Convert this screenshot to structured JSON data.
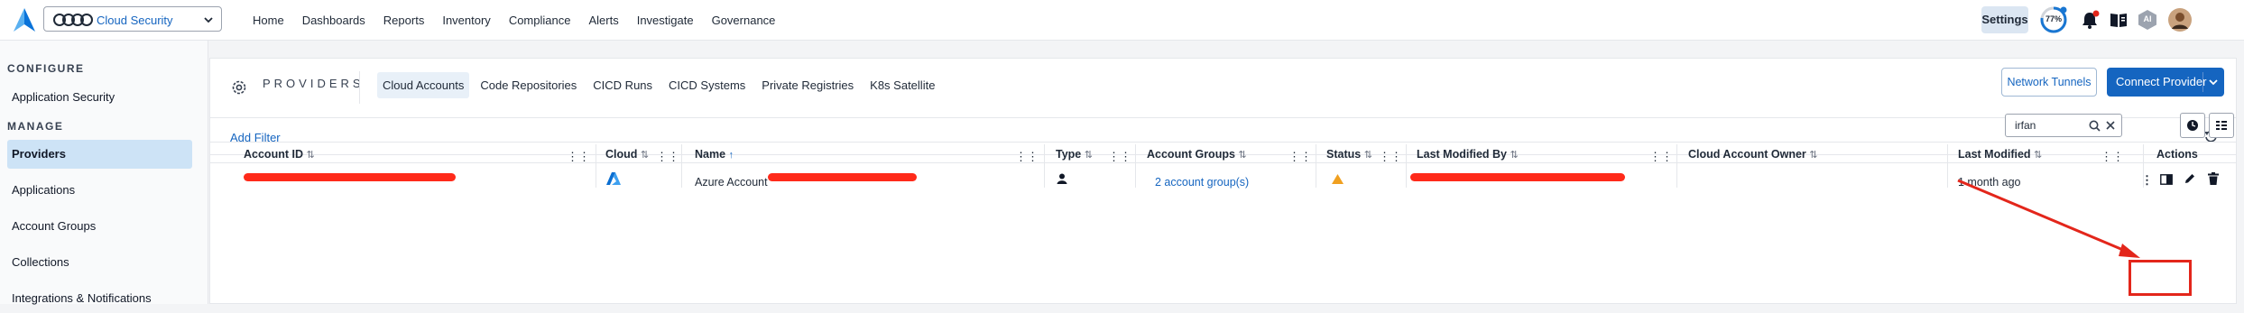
{
  "topbar": {
    "product": "Cloud Security",
    "nav": [
      "Home",
      "Dashboards",
      "Reports",
      "Inventory",
      "Compliance",
      "Alerts",
      "Investigate",
      "Governance"
    ],
    "settings": "Settings",
    "progress": "77%",
    "progress_value": 0.77,
    "avatar_badge": "AI"
  },
  "sidebar": {
    "configure_label": "CONFIGURE",
    "configure_items": [
      "Application Security"
    ],
    "manage_label": "MANAGE",
    "manage_items": [
      "Providers",
      "Applications",
      "Account Groups",
      "Collections",
      "Integrations & Notifications"
    ],
    "active_item": "Providers"
  },
  "page": {
    "title": "PROVIDERS",
    "tabs": [
      "Cloud Accounts",
      "Code Repositories",
      "CICD Runs",
      "CICD Systems",
      "Private Registries",
      "K8s Satellite"
    ],
    "active_tab": "Cloud Accounts",
    "network_tunnels": "Network Tunnels",
    "connect_provider": "Connect Provider",
    "add_filter": "Add Filter",
    "search_value": "irfan"
  },
  "table": {
    "columns": [
      "Account ID",
      "Cloud",
      "Name",
      "Type",
      "Account Groups",
      "Status",
      "Last Modified By",
      "Cloud Account Owner",
      "Last Modified",
      "Actions"
    ],
    "rows": [
      {
        "account_id": "",
        "cloud": "azure-icon",
        "name": "Azure Account",
        "type": "user-icon",
        "account_groups": "2 account group(s)",
        "status": "warning-icon",
        "last_modified_by": "",
        "cloud_account_owner": "",
        "last_modified": "1 month ago"
      }
    ]
  },
  "colors": {
    "accent": "#1565c0",
    "active_bg": "#cde3f6",
    "annotation": "#e3261b",
    "warning": "#f0a020"
  }
}
